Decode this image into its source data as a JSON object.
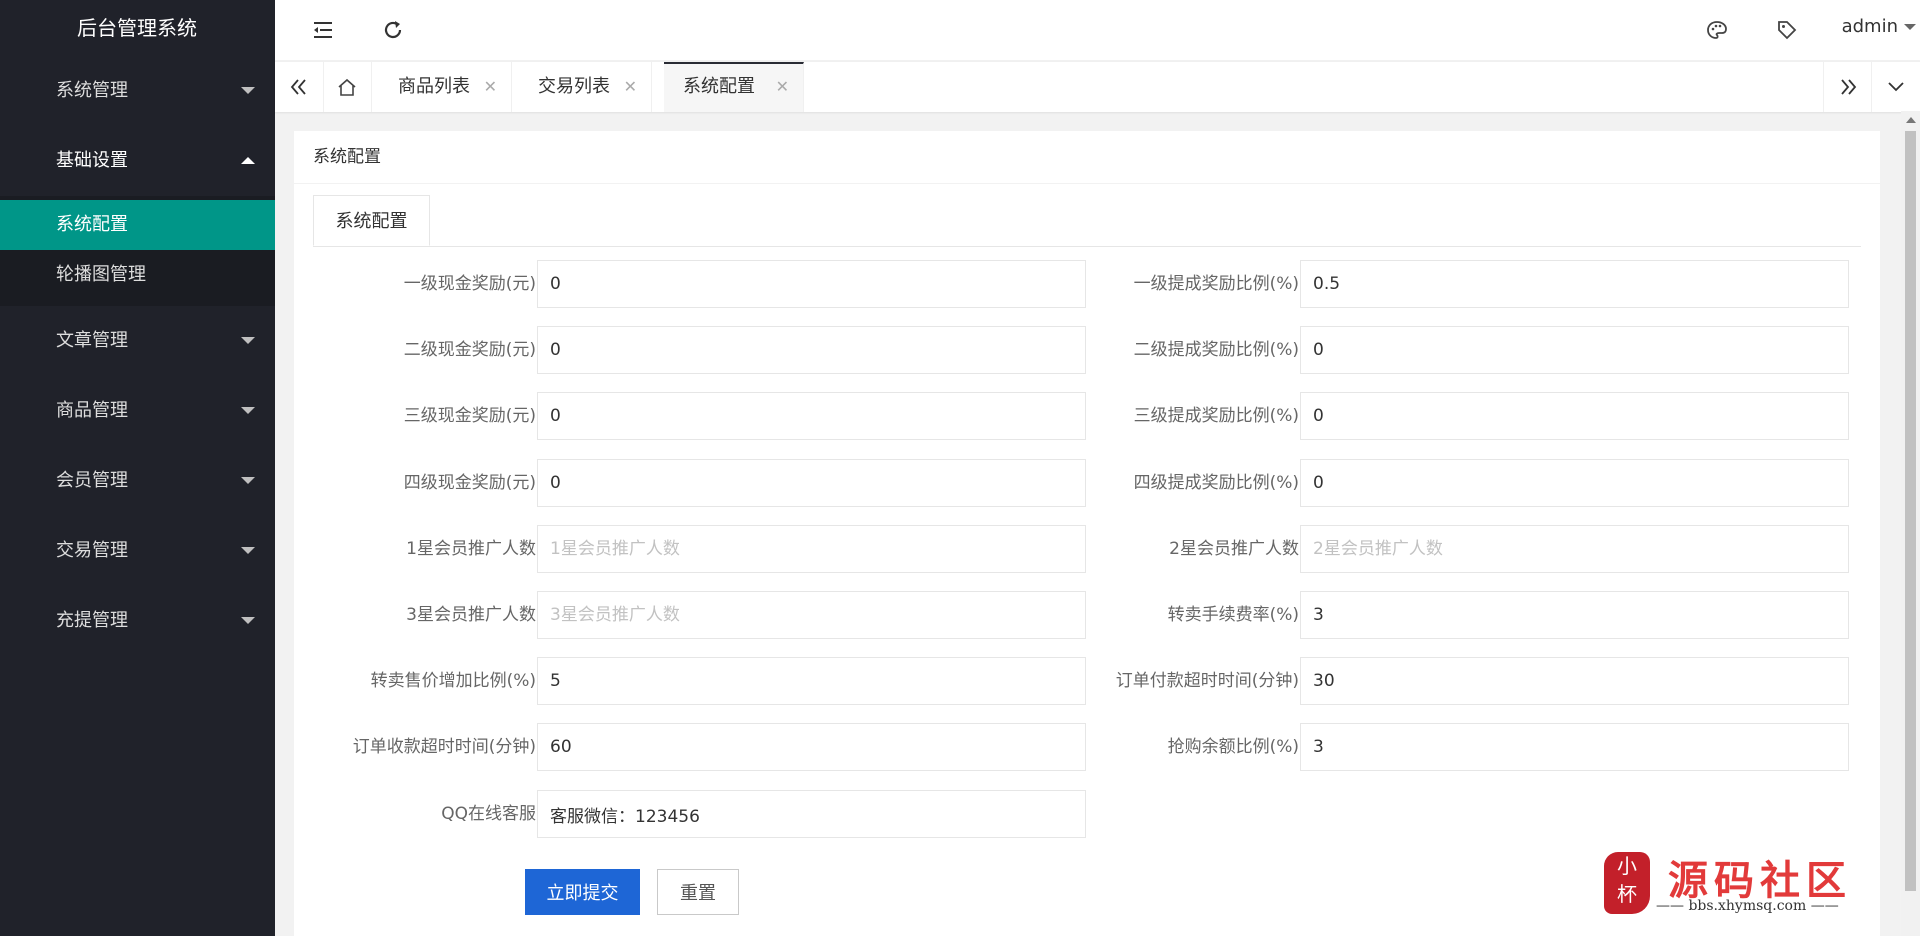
{
  "app": {
    "title": "后台管理系统"
  },
  "sidebar": {
    "items": [
      {
        "label": "系统管理"
      },
      {
        "label": "基础设置",
        "children": [
          {
            "label": "系统配置",
            "active": true
          },
          {
            "label": "轮播图管理"
          }
        ]
      },
      {
        "label": "文章管理"
      },
      {
        "label": "商品管理"
      },
      {
        "label": "会员管理"
      },
      {
        "label": "交易管理"
      },
      {
        "label": "充提管理"
      }
    ]
  },
  "header": {
    "user": "admin",
    "icons": [
      "menu-fold-icon",
      "refresh-icon",
      "theme-palette-icon",
      "tag-icon"
    ]
  },
  "tabs": [
    {
      "label": "商品列表"
    },
    {
      "label": "交易列表"
    },
    {
      "label": "系统配置",
      "active": true
    }
  ],
  "card": {
    "title": "系统配置",
    "inner_tab": "系统配置"
  },
  "form": {
    "fields": [
      {
        "label": "一级现金奖励(元)",
        "value": "0",
        "placeholder": ""
      },
      {
        "label": "一级提成奖励比例(%)",
        "value": "0.5",
        "placeholder": ""
      },
      {
        "label": "二级现金奖励(元)",
        "value": "0",
        "placeholder": ""
      },
      {
        "label": "二级提成奖励比例(%)",
        "value": "0",
        "placeholder": ""
      },
      {
        "label": "三级现金奖励(元)",
        "value": "0",
        "placeholder": ""
      },
      {
        "label": "三级提成奖励比例(%)",
        "value": "0",
        "placeholder": ""
      },
      {
        "label": "四级现金奖励(元)",
        "value": "0",
        "placeholder": ""
      },
      {
        "label": "四级提成奖励比例(%)",
        "value": "0",
        "placeholder": ""
      },
      {
        "label": "1星会员推广人数",
        "value": "",
        "placeholder": "1星会员推广人数"
      },
      {
        "label": "2星会员推广人数",
        "value": "",
        "placeholder": "2星会员推广人数"
      },
      {
        "label": "3星会员推广人数",
        "value": "",
        "placeholder": "3星会员推广人数"
      },
      {
        "label": "转卖手续费率(%)",
        "value": "3",
        "placeholder": ""
      },
      {
        "label": "转卖售价增加比例(%)",
        "value": "5",
        "placeholder": ""
      },
      {
        "label": "订单付款超时时间(分钟)",
        "value": "30",
        "placeholder": ""
      },
      {
        "label": "订单收款超时时间(分钟)",
        "value": "60",
        "placeholder": ""
      },
      {
        "label": "抢购余额比例(%)",
        "value": "3",
        "placeholder": ""
      },
      {
        "label": "QQ在线客服",
        "value": "客服微信：123456",
        "placeholder": ""
      }
    ],
    "submit_label": "立即提交",
    "reset_label": "重置"
  },
  "watermark": {
    "seal": "小 杯",
    "title": "源码社区",
    "url": "—— bbs.xhymsq.com ——"
  },
  "colors": {
    "sidebar_bg": "#20222a",
    "active_green": "#009688",
    "primary_blue": "#1e66d6",
    "watermark_red": "#e23a3a"
  }
}
